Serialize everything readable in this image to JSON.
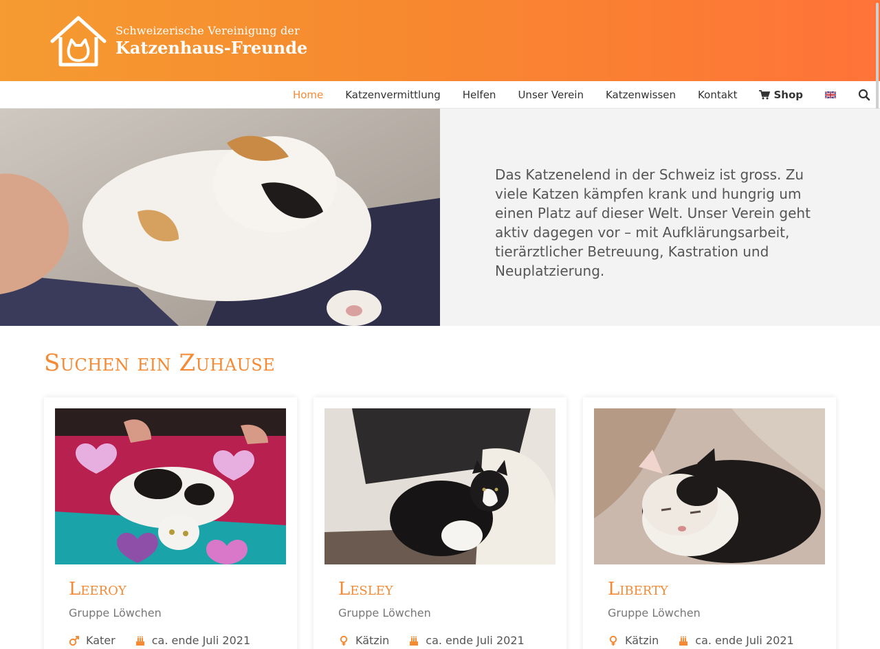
{
  "header": {
    "logo_line1": "Schweizerische Vereinigung der",
    "logo_line2": "Katzenhaus-Freunde"
  },
  "nav": {
    "items": [
      {
        "label": "Home",
        "active": true
      },
      {
        "label": "Katzenvermittlung"
      },
      {
        "label": "Helfen"
      },
      {
        "label": "Unser Verein"
      },
      {
        "label": "Katzenwissen"
      },
      {
        "label": "Kontakt"
      }
    ],
    "shop_label": "Shop",
    "shop_icon": "cart-icon",
    "language_icon": "uk-flag-icon",
    "search_icon": "search-icon"
  },
  "hero": {
    "text": "Das Katzenelend in der Schweiz ist gross. Zu viele Katzen kämpfen krank und hungrig um einen Platz auf dieser Welt. Unser Verein geht aktiv dagegen vor – mit Aufklärungsarbeit, tierärztlicher Betreuung, Kastration und Neuplatzierung."
  },
  "section": {
    "title": "Suchen ein Zuhause"
  },
  "cats": [
    {
      "name": "Leeroy",
      "group": "Gruppe Löwchen",
      "sex": "Kater",
      "sex_icon": "male-icon",
      "born": "ca. ende Juli 2021",
      "born_icon": "birthday-cake-icon"
    },
    {
      "name": "Lesley",
      "group": "Gruppe Löwchen",
      "sex": "Kätzin",
      "sex_icon": "female-icon",
      "born": "ca. ende Juli 2021",
      "born_icon": "birthday-cake-icon"
    },
    {
      "name": "Liberty",
      "group": "Gruppe Löwchen",
      "sex": "Kätzin",
      "sex_icon": "female-icon",
      "born": "ca. ende Juli 2021",
      "born_icon": "birthday-cake-icon"
    }
  ],
  "colors": {
    "brand_orange": "#f58a35",
    "header_gradient_start": "#f59b31",
    "header_gradient_end": "#ff7338"
  }
}
